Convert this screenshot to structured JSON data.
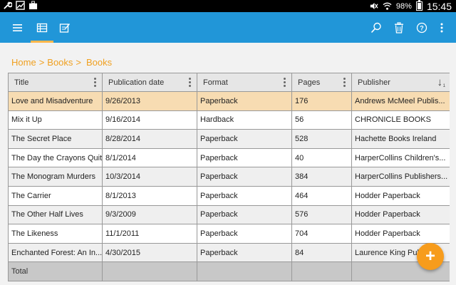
{
  "status_bar": {
    "battery": "98%",
    "time": "15:45",
    "icons": [
      "wrench-icon",
      "image-icon",
      "briefcase-icon",
      "mute-icon",
      "wifi-icon",
      "battery-icon"
    ]
  },
  "toolbar": {
    "icons": [
      "menu-icon",
      "table-view-icon",
      "edit-form-icon",
      "search-icon",
      "delete-icon",
      "help-icon",
      "overflow-menu-icon"
    ]
  },
  "breadcrumb": {
    "home": "Home",
    "sep1": ">",
    "books1": "Books",
    "sep2": ">",
    "books2": "Books"
  },
  "table": {
    "columns": [
      "Title",
      "Publication date",
      "Format",
      "Pages",
      "Publisher"
    ],
    "sort": {
      "column": "Publisher",
      "direction": "descending",
      "order": "1"
    },
    "rows": [
      {
        "title": "Love and Misadventure",
        "date": "9/26/2013",
        "format": "Paperback",
        "pages": "176",
        "publisher": "Andrews McMeel Publis..."
      },
      {
        "title": "Mix it Up",
        "date": "9/16/2014",
        "format": "Hardback",
        "pages": "56",
        "publisher": "CHRONICLE BOOKS"
      },
      {
        "title": "The Secret Place",
        "date": "8/28/2014",
        "format": "Paperback",
        "pages": "528",
        "publisher": "Hachette Books Ireland"
      },
      {
        "title": "The Day the Crayons Quit",
        "date": "8/1/2014",
        "format": "Paperback",
        "pages": "40",
        "publisher": "HarperCollins Children's..."
      },
      {
        "title": "The Monogram Murders",
        "date": "10/3/2014",
        "format": "Paperback",
        "pages": "384",
        "publisher": "HarperCollins Publishers..."
      },
      {
        "title": "The Carrier",
        "date": "8/1/2013",
        "format": "Paperback",
        "pages": "464",
        "publisher": "Hodder Paperback"
      },
      {
        "title": "The Other Half Lives",
        "date": "9/3/2009",
        "format": "Paperback",
        "pages": "576",
        "publisher": "Hodder Paperback"
      },
      {
        "title": "The Likeness",
        "date": "11/1/2011",
        "format": "Paperback",
        "pages": "704",
        "publisher": "Hodder Paperback"
      },
      {
        "title": "Enchanted Forest: An In...",
        "date": "4/30/2015",
        "format": "Paperback",
        "pages": "84",
        "publisher": "Laurence King Publ..."
      }
    ],
    "total_label": "Total",
    "selected_row": 0
  },
  "fab": {
    "label": "+",
    "icon": "add-icon"
  },
  "colors": {
    "appbar": "#2196d8",
    "accent": "#f79c1c",
    "selected_row": "#f7dcb2",
    "breadcrumb": "#f0a020"
  }
}
